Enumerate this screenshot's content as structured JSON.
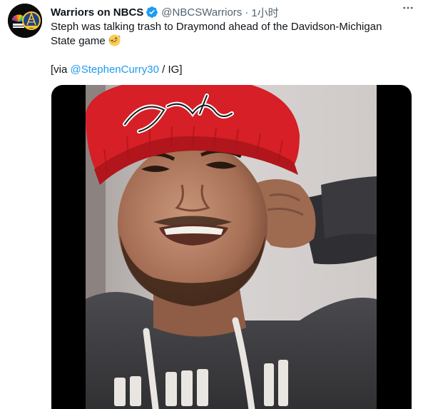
{
  "tweet": {
    "display_name": "Warriors on NBCS",
    "handle": "@NBCSWarriors",
    "separator": "·",
    "time": "1小时",
    "text_line1": "Steph was talking trash to Draymond ahead of the Davidson-Michigan State game",
    "emoji": "rolling-on-floor-laughing-emoji",
    "credit_prefix": "[via ",
    "credit_mention": "@StephenCurry30",
    "credit_suffix": " / IG]"
  },
  "icons": {
    "verified": "verified-badge-icon",
    "more": "more-options-icon"
  },
  "colors": {
    "link": "#1d9bf0",
    "secondary_text": "#536471",
    "primary_text": "#0f1419",
    "beanie": "#d61f26",
    "media_background": "#000000"
  }
}
